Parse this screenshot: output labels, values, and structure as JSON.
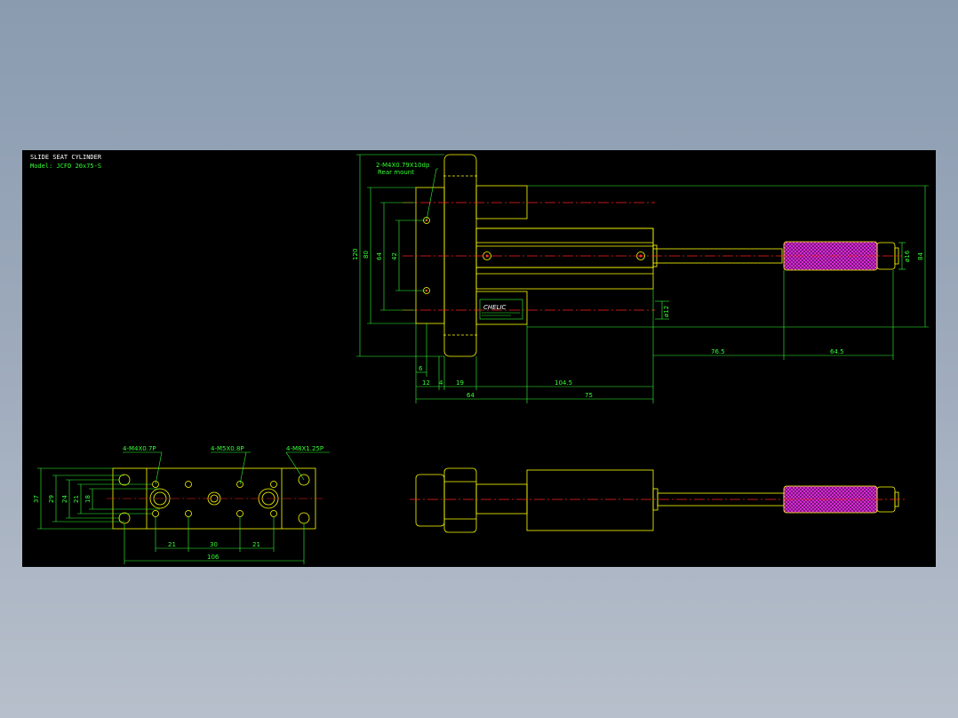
{
  "title_block": {
    "title": "SLIDE SEAT CYLINDER",
    "model": "Model: JCFD 20x75-S"
  },
  "colors": {
    "background": "#000000",
    "outline": "#ffff00",
    "dimension": "#33ff33",
    "centerline": "#ff2020",
    "knurl": "#ff33ff"
  },
  "side_view": {
    "callout": "2-M4X0.79X10dp",
    "callout_note": "Rear mount",
    "logo": "CHELIC",
    "dims": {
      "d120": "120",
      "d80": "80",
      "d64": "64",
      "d42": "42",
      "d6": "6",
      "d12": "12",
      "d4": "4",
      "d19": "19",
      "d104_5": "104.5",
      "d64_bottom": "64",
      "d75": "75",
      "d76_5": "76.5",
      "d64_5": "64.5",
      "dia16": "ø16",
      "d84": "84",
      "dia12": "ø12"
    }
  },
  "end_view": {
    "callout_m4": "4-M4X0.7P",
    "callout_m5": "4-M5X0.8P",
    "callout_m8": "4-M8X1.25P",
    "dims": {
      "d37": "37",
      "d29": "29",
      "d24": "24",
      "d21_v": "21",
      "d18": "18",
      "d21_left": "21",
      "d30": "30",
      "d21_right": "21",
      "d106": "106"
    }
  }
}
